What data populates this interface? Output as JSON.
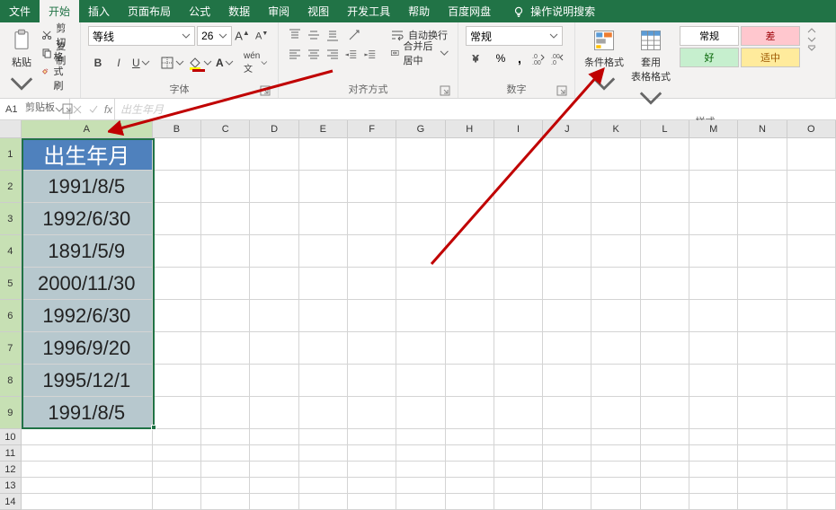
{
  "tabs": {
    "file": "文件",
    "home": "开始",
    "insert": "插入",
    "layout": "页面布局",
    "formulas": "公式",
    "data": "数据",
    "review": "审阅",
    "view": "视图",
    "dev": "开发工具",
    "help": "帮助",
    "baidu": "百度网盘",
    "tell": "操作说明搜索"
  },
  "ribbon": {
    "clipboard": {
      "label": "剪贴板",
      "paste": "粘贴",
      "cut": "剪切",
      "copy": "复制",
      "painter": "格式刷"
    },
    "font": {
      "label": "字体",
      "name": "等线",
      "size": "26"
    },
    "alignment": {
      "label": "对齐方式",
      "wrap": "自动换行",
      "merge": "合并后居中"
    },
    "number": {
      "label": "数字",
      "format": "常规"
    },
    "styles": {
      "label": "样式",
      "cond": "条件格式",
      "table": "套用\n表格格式",
      "normal": "常规",
      "bad": "差",
      "good": "好",
      "neutral": "适中"
    }
  },
  "namebox": "A1",
  "fx_preview": "出生年月",
  "columns": [
    "A",
    "B",
    "C",
    "D",
    "E",
    "F",
    "G",
    "H",
    "I",
    "J",
    "K",
    "L",
    "M",
    "N",
    "O"
  ],
  "data_column": {
    "header": "出生年月",
    "values": [
      "1991/8/5",
      "1992/6/30",
      "1891/5/9",
      "2000/11/30",
      "1992/6/30",
      "1996/9/20",
      "1995/12/1",
      "1991/8/5"
    ]
  },
  "row_count": 14
}
